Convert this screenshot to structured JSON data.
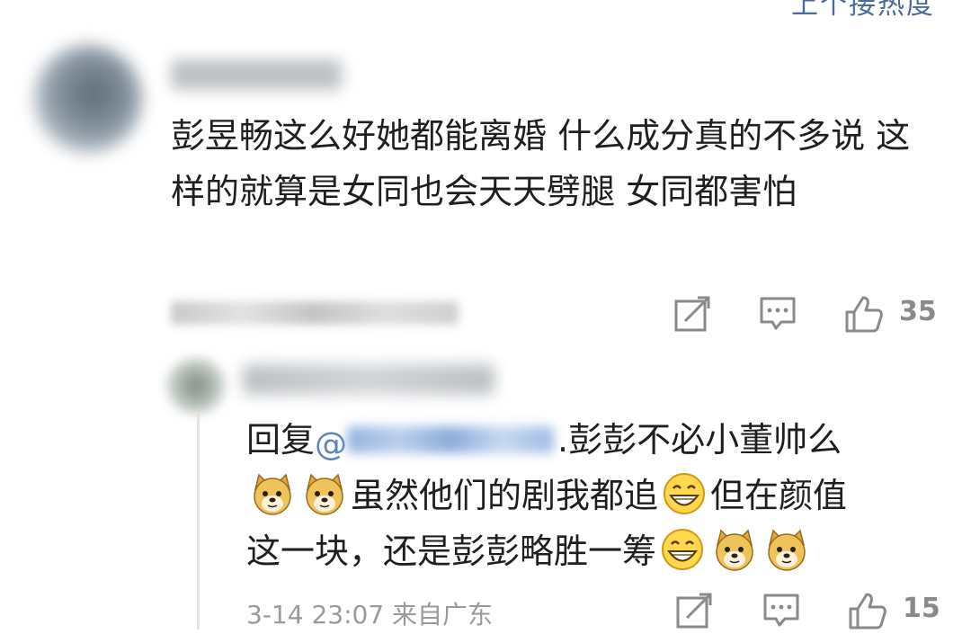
{
  "top_link": "上个接热度",
  "comment": {
    "text": "彭昱畅这么好她都能离婚 什么成分真的不多说 这样的就算是女同也会天天劈腿 女同都害怕",
    "like_count": "35"
  },
  "reply": {
    "prefix": "回复",
    "at_sign": "@",
    "after_mention": ".彭彭不必小董帅么",
    "line2": "虽然他们的剧我都追",
    "line2b": "但在颜值",
    "line3": "这一块，还是彭彭略胜一筹",
    "time": "3-14 23:07",
    "location": "来自广东",
    "like_count": "15"
  },
  "icons": {
    "share": "share-icon",
    "comment": "comment-icon",
    "like": "thumbs-up-icon",
    "doge": "doge-emoji-icon",
    "grin": "grin-emoji-icon"
  },
  "colors": {
    "link": "#4a6a9c",
    "mention": "#5b86c2",
    "icon": "#8a8a8a"
  }
}
